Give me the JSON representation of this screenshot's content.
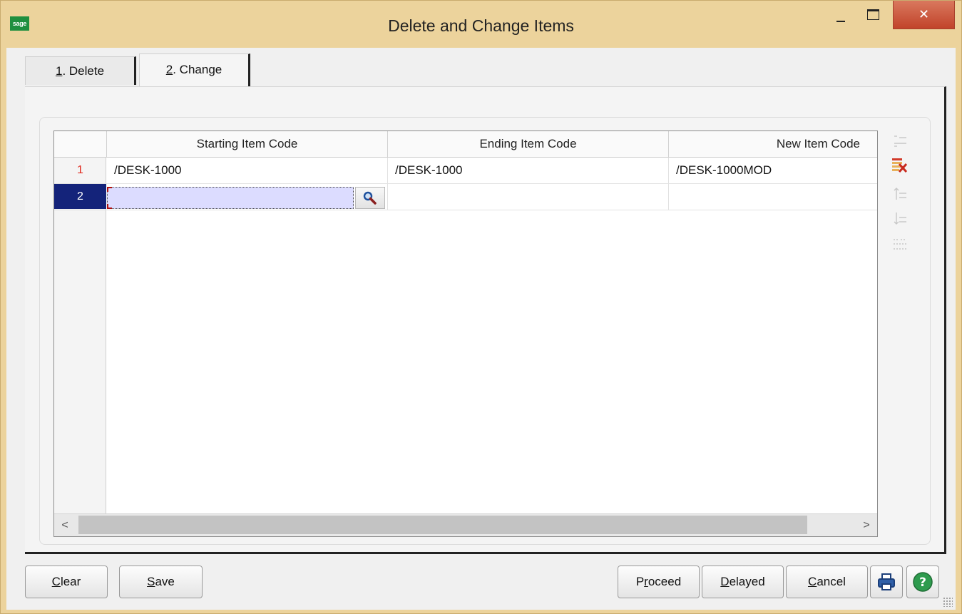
{
  "window": {
    "title": "Delete and Change Items",
    "logo_text": "sage",
    "close_label": "✕",
    "brand_color": "#1f8f3f",
    "frame_color": "#ecd39c"
  },
  "tabs": [
    {
      "num": "1",
      "rest": ". Delete",
      "active": false
    },
    {
      "num": "2",
      "rest": ". Change",
      "active": true
    }
  ],
  "grid": {
    "columns": [
      "Starting Item Code",
      "Ending Item Code",
      "New Item Code"
    ],
    "rows": [
      {
        "num": "1",
        "starting": "/DESK-1000",
        "ending": "/DESK-1000",
        "new": "/DESK-1000MOD"
      },
      {
        "num": "2",
        "starting": "",
        "ending": "",
        "new": ""
      }
    ],
    "selected_row": "2",
    "scroll_left_arrow": "<",
    "scroll_right_arrow": ">"
  },
  "side_tools": [
    "insert-row-icon",
    "delete-row-icon",
    "move-up-icon",
    "move-down-icon",
    "renumber-icon"
  ],
  "buttons": {
    "clear": {
      "u": "C",
      "rest": "lear"
    },
    "save": {
      "u": "S",
      "rest": "ave"
    },
    "proceed": {
      "pre": "P",
      "u": "r",
      "rest": "oceed"
    },
    "delayed": {
      "u": "D",
      "rest": "elayed"
    },
    "cancel": {
      "u": "C",
      "rest": "ancel"
    }
  }
}
